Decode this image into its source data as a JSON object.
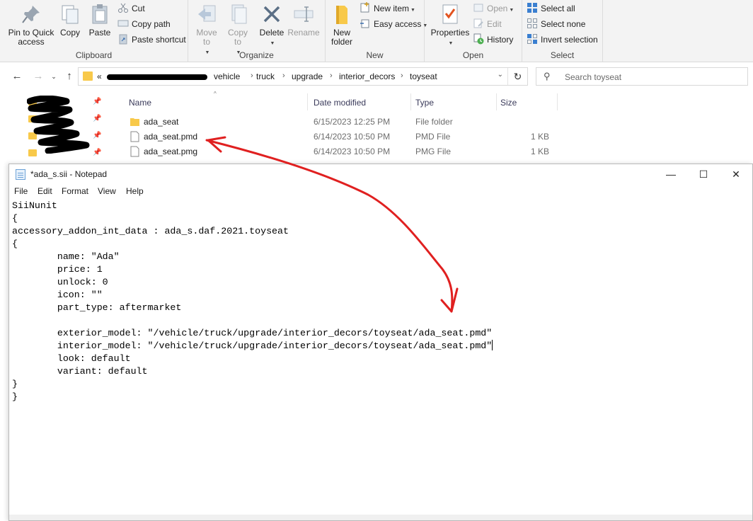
{
  "ribbon": {
    "clipboard": {
      "label": "Clipboard",
      "pin": "Pin to Quick access",
      "copy": "Copy",
      "paste": "Paste",
      "cut": "Cut",
      "copy_path": "Copy path",
      "paste_shortcut": "Paste shortcut"
    },
    "organize": {
      "label": "Organize",
      "move_to": "Move to",
      "copy_to": "Copy to",
      "delete": "Delete",
      "rename": "Rename"
    },
    "new": {
      "label": "New",
      "new_folder": "New folder",
      "new_item": "New item",
      "easy_access": "Easy access"
    },
    "open": {
      "label": "Open",
      "properties": "Properties",
      "open": "Open",
      "edit": "Edit",
      "history": "History"
    },
    "select": {
      "label": "Select",
      "select_all": "Select all",
      "select_none": "Select none",
      "invert_selection": "Invert selection"
    }
  },
  "address": {
    "overflow": "«",
    "breadcrumbs": [
      "vehicle",
      "truck",
      "upgrade",
      "interior_decors",
      "toyseat"
    ],
    "search_placeholder": "Search toyseat"
  },
  "file_list": {
    "columns": {
      "name": "Name",
      "date": "Date modified",
      "type": "Type",
      "size": "Size"
    },
    "rows": [
      {
        "name": "ada_seat",
        "date": "6/15/2023 12:25 PM",
        "type": "File folder",
        "size": "",
        "icon": "folder-icon"
      },
      {
        "name": "ada_seat.pmd",
        "date": "6/14/2023 10:50 PM",
        "type": "PMD File",
        "size": "1 KB",
        "icon": "file-icon"
      },
      {
        "name": "ada_seat.pmg",
        "date": "6/14/2023 10:50 PM",
        "type": "PMG File",
        "size": "1 KB",
        "icon": "file-icon"
      }
    ]
  },
  "notepad": {
    "title": "*ada_s.sii - Notepad",
    "menu": [
      "File",
      "Edit",
      "Format",
      "View",
      "Help"
    ],
    "lines": [
      "SiiNunit",
      "{",
      "accessory_addon_int_data : ada_s.daf.2021.toyseat",
      "{",
      "        name: \"Ada\"",
      "        price: 1",
      "        unlock: 0",
      "        icon: \"\"",
      "        part_type: aftermarket",
      "",
      "        exterior_model: \"/vehicle/truck/upgrade/interior_decors/toyseat/ada_seat.pmd\"",
      "        interior_model: \"/vehicle/truck/upgrade/interior_decors/toyseat/ada_seat.pmd\"",
      "        look: default",
      "        variant: default",
      "}",
      "}"
    ]
  },
  "colors": {
    "ribbon_bg": "#f3f3f3",
    "folder": "#f8c94a",
    "annotation": "#e02020",
    "accent": "#1a73c8"
  }
}
